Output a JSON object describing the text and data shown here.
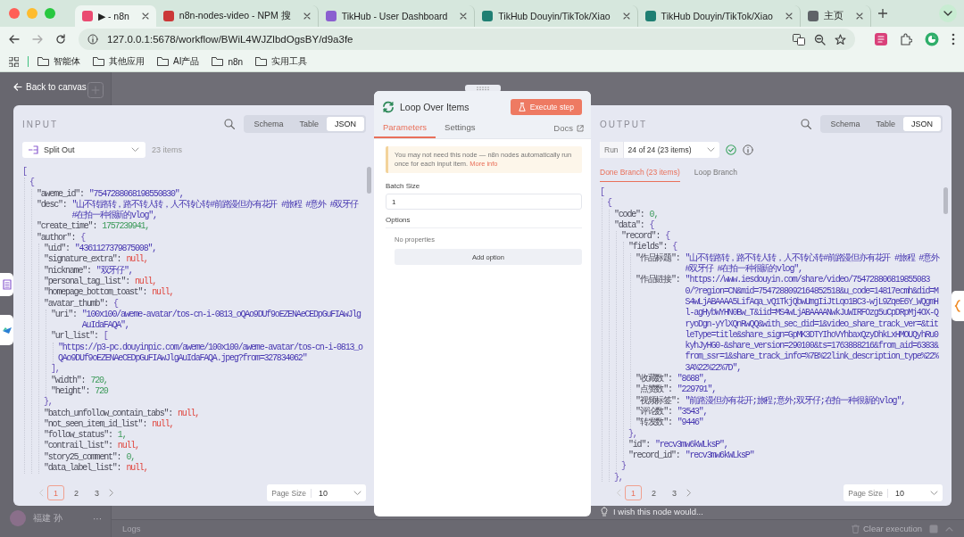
{
  "browser": {
    "tabs": [
      {
        "title": "▶ - n8n",
        "color": "#ea4b71",
        "selected": true
      },
      {
        "title": "n8n-nodes-video - NPM 搜",
        "color": "#cb3837",
        "selected": false
      },
      {
        "title": "TikHub - User Dashboard",
        "color": "#8b5fd0",
        "selected": false
      },
      {
        "title": "TikHub Douyin/TikTok/Xiao",
        "color": "#1f7f73",
        "selected": false
      },
      {
        "title": "TikHub Douyin/TikTok/Xiao",
        "color": "#1f7f73",
        "selected": false
      },
      {
        "title": "主页",
        "color": "#5f6368",
        "selected": false
      }
    ],
    "address": "127.0.0.1:5678/workflow/BWiL4WJZlbdOgsBY/d9a3fe",
    "bookmarks": [
      "智能体",
      "其他应用",
      "AI产品",
      "n8n",
      "实用工具"
    ]
  },
  "canvas": {
    "back_link": "Back to canvas",
    "user_name": "福建 孙",
    "user_menu": "···",
    "feedback": "I wish this node would...",
    "logs": "Logs",
    "clear_execution": "Clear execution"
  },
  "input_panel": {
    "title": "INPUT",
    "views": [
      {
        "label": "Schema",
        "selected": false
      },
      {
        "label": "Table",
        "selected": false
      },
      {
        "label": "JSON",
        "selected": true
      }
    ],
    "source": "Split Out",
    "item_count": "23 items",
    "code": [
      {
        "open": "[",
        "children": [
          {
            "open": "{",
            "children": [
              {
                "key": "\"aweme_id\":",
                "value": "\"7547288068198550830\",",
                "kind": "string"
              },
              {
                "key": "\"desc\":",
                "value": "\"山不转路转，路不转人转，人不转心转#前路漫但亦有花开 #旅程 #意外 #双牙仔 #在拍一种很新的vlog\",",
                "kind": "string"
              },
              {
                "key": "\"create_time\":",
                "value": "1757239941,",
                "kind": "number"
              },
              {
                "key": "\"author\":",
                "open": "{",
                "children": [
                  {
                    "key": "\"uid\":",
                    "value": "\"4361127379875008\",",
                    "kind": "string"
                  },
                  {
                    "key": "\"signature_extra\":",
                    "value": "null,",
                    "kind": "null"
                  },
                  {
                    "key": "\"nickname\":",
                    "value": "\"双牙仔\",",
                    "kind": "string"
                  },
                  {
                    "key": "\"personal_tag_list\":",
                    "value": "null,",
                    "kind": "null"
                  },
                  {
                    "key": "\"homepage_bottom_toast\":",
                    "value": "null,",
                    "kind": "null"
                  },
                  {
                    "key": "\"avatar_thumb\":",
                    "open": "{",
                    "children": [
                      {
                        "key": "\"uri\":",
                        "value": "\"100x100/aweme-avatar/tos-cn-i-0813_oQAo9DUf9oEZENAeCEDpGuFIAwJlgAuIdaFAQA\",",
                        "kind": "string"
                      },
                      {
                        "key": "\"url_list\":",
                        "open": "[",
                        "children": [
                          {
                            "value": "\"https://p3-pc.douyinpic.com/aweme/100x100/aweme-avatar/tos-cn-i-0813_oQAo9DUf9oEZENAeCEDpGuFIAwJlgAuIdaFAQA.jpeg?from=327834062\"",
                            "kind": "string"
                          }
                        ],
                        "close": "],"
                      },
                      {
                        "key": "\"width\":",
                        "value": "720,",
                        "kind": "number"
                      },
                      {
                        "key": "\"height\":",
                        "value": "720",
                        "kind": "number"
                      }
                    ],
                    "close": "},"
                  },
                  {
                    "key": "\"batch_unfollow_contain_tabs\":",
                    "value": "null,",
                    "kind": "null"
                  },
                  {
                    "key": "\"not_seen_item_id_list\":",
                    "value": "null,",
                    "kind": "null"
                  },
                  {
                    "key": "\"follow_status\":",
                    "value": "1,",
                    "kind": "number"
                  },
                  {
                    "key": "\"contrail_list\":",
                    "value": "null,",
                    "kind": "null"
                  },
                  {
                    "key": "\"story25_comment\":",
                    "value": "0,",
                    "kind": "number"
                  },
                  {
                    "key": "\"data_label_list\":",
                    "value": "null,",
                    "kind": "null"
                  }
                ]
              }
            ]
          }
        ]
      }
    ],
    "pages": [
      {
        "label": "1",
        "selected": true
      },
      {
        "label": "2",
        "selected": false
      },
      {
        "label": "3",
        "selected": false
      }
    ],
    "page_size_label": "Page Size",
    "page_size": "10"
  },
  "node_panel": {
    "title": "Loop Over Items",
    "execute": "Execute step",
    "tabs": [
      {
        "label": "Parameters",
        "selected": true
      },
      {
        "label": "Settings",
        "selected": false
      }
    ],
    "docs": "Docs",
    "notice": "You may not need this node — n8n nodes automatically run once for each input item.",
    "notice_link": "More info",
    "batch_label": "Batch Size",
    "batch_value": "1",
    "options_label": "Options",
    "no_properties": "No properties",
    "add_option": "Add option"
  },
  "output_panel": {
    "title": "OUTPUT",
    "views": [
      {
        "label": "Schema",
        "selected": false
      },
      {
        "label": "Table",
        "selected": false
      },
      {
        "label": "JSON",
        "selected": true
      }
    ],
    "run_label": "Run",
    "run": "24 of 24 (23 items)",
    "branches": [
      {
        "label": "Done Branch (23 items)",
        "selected": true
      },
      {
        "label": "Loop Branch",
        "selected": false
      }
    ],
    "code": [
      {
        "open": "[",
        "children": [
          {
            "open": "{",
            "children": [
              {
                "key": "\"code\":",
                "value": "0,",
                "kind": "number"
              },
              {
                "key": "\"data\":",
                "open": "{",
                "children": [
                  {
                    "key": "\"record\":",
                    "open": "{",
                    "children": [
                      {
                        "key": "\"fields\":",
                        "open": "{",
                        "children": [
                          {
                            "key": "\"作品标题\":",
                            "value": "\"山不转路转，路不转人转，人不转心转#前路漫但亦有花开 #旅程 #意外 #双牙仔 #在拍一种很新的vlog\",",
                            "kind": "string"
                          },
                          {
                            "key": "\"作品链接\":",
                            "value": "\"https://www.iesdouyin.com/share/video/7547288068198550830/?region=CN&mid=7547288092164852518&u_code=14817ecmh&did=MS4wLjABAAAA5LifAqa_vQ1TkjQbwUmgIiJtLqo1BC3-wjL9ZqeE6Y_WQgmHl-agHybWYHN0Bw_T&iid=MS4wLjABAAAANwkJuWIRFOzg5uCpDRpMj4OX-QryoDgn-yYlXQnRwQQ&with_sec_did=1&video_share_track_ver=&titleType=title&share_sign=GpMK3DTYIhoVYhbaxQzyDhkLxHMOUQyhRu0kyhJyHG0-&share_version=290100&ts=1763888216&from_aid=6383&from_ssr=1&share_track_info=%7B%22link_description_type%22%3A%22%22%7D\",",
                            "kind": "string"
                          },
                          {
                            "key": "\"收藏数\":",
                            "value": "\"8688\",",
                            "kind": "string"
                          },
                          {
                            "key": "\"点赞数\":",
                            "value": "\"229791\",",
                            "kind": "string"
                          },
                          {
                            "key": "\"视频标签\":",
                            "value": "\"前路漫但亦有花开;旅程;意外;双牙仔;在拍一种很新的vlog\",",
                            "kind": "string"
                          },
                          {
                            "key": "\"评论数\":",
                            "value": "\"3543\",",
                            "kind": "string"
                          },
                          {
                            "key": "\"转发数\":",
                            "value": "\"9446\"",
                            "kind": "string"
                          }
                        ],
                        "close": "},"
                      },
                      {
                        "key": "\"id\":",
                        "value": "\"recv3mw6kWLksP\",",
                        "kind": "string"
                      },
                      {
                        "key": "\"record_id\":",
                        "value": "\"recv3mw6kWLksP\"",
                        "kind": "string"
                      }
                    ],
                    "close": "}"
                  }
                ],
                "close": "},"
              }
            ]
          }
        ]
      }
    ],
    "pages": [
      {
        "label": "1",
        "selected": true
      },
      {
        "label": "2",
        "selected": false
      },
      {
        "label": "3",
        "selected": false
      }
    ],
    "page_size_label": "Page Size",
    "page_size": "10"
  }
}
